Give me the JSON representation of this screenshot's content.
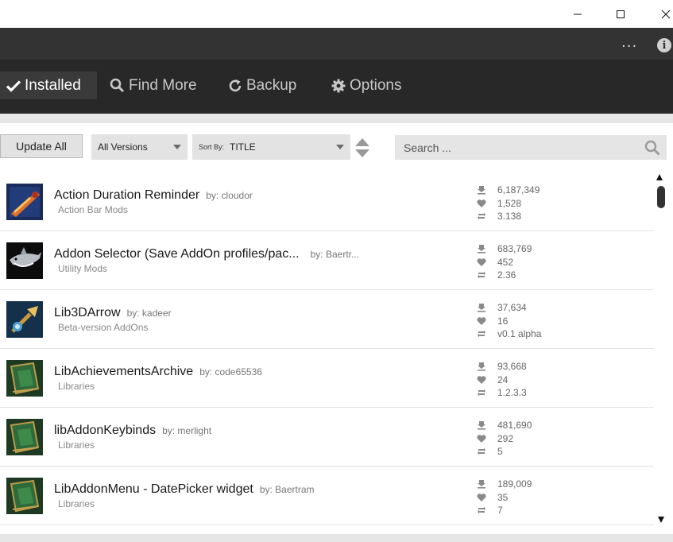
{
  "window": {
    "minimize_symbol": "—",
    "maximize_symbol": "☐",
    "close_symbol": "✕"
  },
  "topbar": {
    "more_label": "...",
    "info_label": "i"
  },
  "nav": {
    "installed": "Installed",
    "find_more": "Find More",
    "backup": "Backup",
    "options": "Options"
  },
  "toolbar": {
    "update_all": "Update All",
    "versions_value": "All Versions",
    "sort_label": "Sort By:",
    "sort_value": "TITLE",
    "search_placeholder": "Search ..."
  },
  "addons": [
    {
      "title": "Action Duration Reminder",
      "author": "by: cloudor",
      "category": "Action Bar Mods",
      "downloads": "6,187,349",
      "favorites": "1,528",
      "version": "3.138",
      "icon": "action-icon"
    },
    {
      "title": "Addon Selector (Save AddOn profiles/pac...",
      "author": "by: Baertr...",
      "category": "Utility Mods",
      "downloads": "683,769",
      "favorites": "452",
      "version": "2.36",
      "icon": "shark-icon"
    },
    {
      "title": "Lib3DArrow",
      "author": "by: kadeer",
      "category": "Beta-version AddOns",
      "downloads": "37,634",
      "favorites": "16",
      "version": "v0.1 alpha",
      "icon": "arrow-icon"
    },
    {
      "title": "LibAchievementsArchive",
      "author": "by: code65536",
      "category": "Libraries",
      "downloads": "93,668",
      "favorites": "24",
      "version": "1.2.3.3",
      "icon": "book-icon"
    },
    {
      "title": "libAddonKeybinds",
      "author": "by: merlight",
      "category": "Libraries",
      "downloads": "481,690",
      "favorites": "292",
      "version": "5",
      "icon": "book-icon"
    },
    {
      "title": "LibAddonMenu - DatePicker widget",
      "author": "by: Baertram",
      "category": "Libraries",
      "downloads": "189,009",
      "favorites": "35",
      "version": "7",
      "icon": "book-icon"
    }
  ],
  "colors": {
    "nav_bg": "#282828",
    "topbar_bg": "#333333",
    "active_tab": "#3a3a3a"
  }
}
